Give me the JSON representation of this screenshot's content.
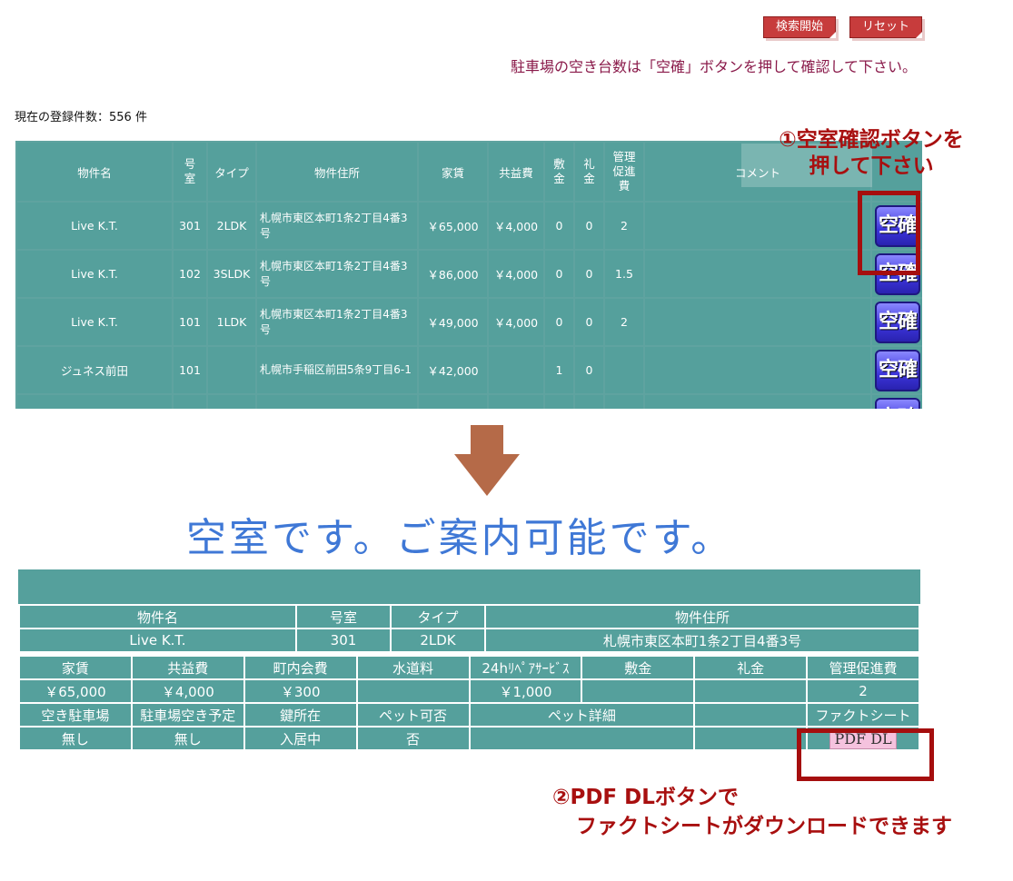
{
  "toolbar": {
    "search_label": "検索開始",
    "reset_label": "リセット"
  },
  "notice": "駐車場の空き台数は「空確」ボタンを押して確認して下さい。",
  "record_count": "現在の登録件数：556 件",
  "list": {
    "headers": {
      "name": "物件名",
      "room": "号室",
      "type": "タイプ",
      "address": "物件住所",
      "rent": "家賃",
      "common": "共益費",
      "deposit": "敷金",
      "key_money": "礼金",
      "mgmt": "管理促進費",
      "comment": "コメント"
    },
    "button_label": "空確",
    "rows": [
      {
        "name": "Live K.T.",
        "room": "301",
        "type": "2LDK",
        "address": "札幌市東区本町1条2丁目4番3号",
        "rent": "￥65,000",
        "common": "￥4,000",
        "deposit": "0",
        "key_money": "0",
        "mgmt": "2",
        "comment": ""
      },
      {
        "name": "Live K.T.",
        "room": "102",
        "type": "3SLDK",
        "address": "札幌市東区本町1条2丁目4番3号",
        "rent": "￥86,000",
        "common": "￥4,000",
        "deposit": "0",
        "key_money": "0",
        "mgmt": "1.5",
        "comment": ""
      },
      {
        "name": "Live K.T.",
        "room": "101",
        "type": "1LDK",
        "address": "札幌市東区本町1条2丁目4番3号",
        "rent": "￥49,000",
        "common": "￥4,000",
        "deposit": "0",
        "key_money": "0",
        "mgmt": "2",
        "comment": ""
      },
      {
        "name": "ジュネス前田",
        "room": "101",
        "type": "",
        "address": "札幌市手稲区前田5条9丁目6-1",
        "rent": "￥42,000",
        "common": "",
        "deposit": "1",
        "key_money": "0",
        "mgmt": "",
        "comment": ""
      }
    ]
  },
  "callout1": {
    "line1": "①空室確認ボタンを",
    "line2": "押して下さい"
  },
  "headline": "空室です。ご案内可能です。",
  "detail": {
    "row1_labels": {
      "name": "物件名",
      "room": "号室",
      "type": "タイプ",
      "address": "物件住所"
    },
    "row1_values": {
      "name": "Live K.T.",
      "room": "301",
      "type": "2LDK",
      "address": "札幌市東区本町1条2丁目4番3号"
    },
    "row2_labels": {
      "rent": "家賃",
      "common": "共益費",
      "town": "町内会費",
      "water": "水道料",
      "repair": "24hﾘﾍﾟｱｻｰﾋﾞｽ",
      "deposit": "敷金",
      "key_money": "礼金",
      "mgmt": "管理促進費"
    },
    "row2_values": {
      "rent": "￥65,000",
      "common": "￥4,000",
      "town": "￥300",
      "water": "",
      "repair": "￥1,000",
      "deposit": "",
      "key_money": "",
      "mgmt": "2"
    },
    "row3_labels": {
      "parking": "空き駐車場",
      "parking_plan": "駐車場空き予定",
      "key": "鍵所在",
      "pet": "ペット可否",
      "pet_detail": "ペット詳細",
      "blank": "",
      "factsheet": "ファクトシート"
    },
    "row3_values": {
      "parking": "無し",
      "parking_plan": "無し",
      "key": "入居中",
      "pet": "否",
      "pet_detail": "",
      "blank": ""
    },
    "pdf_label": "PDF DL"
  },
  "callout2": {
    "line1": "②PDF  DLボタンで",
    "line2": "ファクトシートがダウンロードできます"
  },
  "colors": {
    "teal": "#55a09c",
    "accent_red": "#a80f0f",
    "headline_blue": "#3f78d6",
    "button_red": "#c73c3c"
  }
}
